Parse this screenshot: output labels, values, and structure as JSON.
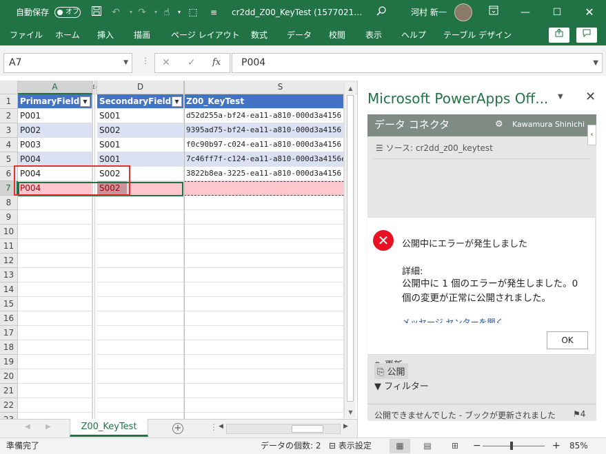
{
  "titlebar": {
    "autosave_label": "自動保存",
    "autosave_state": "オフ",
    "save_icon": "save-icon",
    "filename": "cr2dd_Z00_KeyTest (1577021…",
    "user_name": "河村 新一"
  },
  "ribbon": {
    "tabs": [
      "ファイル",
      "ホーム",
      "挿入",
      "描画",
      "ページ レイアウト",
      "数式",
      "データ",
      "校閲",
      "表示",
      "ヘルプ",
      "テーブル デザイン"
    ]
  },
  "formula_bar": {
    "name_box": "A7",
    "fx_label": "fx",
    "value": "P004"
  },
  "grid": {
    "columns": [
      "A",
      "D",
      "S"
    ],
    "hidden_col_marker": "E(",
    "row_numbers": [
      "1",
      "2",
      "3",
      "4",
      "5",
      "6",
      "7",
      "8",
      "9",
      "10",
      "11",
      "12",
      "13",
      "14",
      "15",
      "16",
      "17",
      "18",
      "19",
      "20",
      "21",
      "22",
      "23"
    ],
    "headers": [
      "PrimaryField",
      "SecondaryField",
      "Z00_KeyTest"
    ],
    "rows": [
      [
        "P001",
        "S001",
        "d52d255a-bf24-ea11-a810-000d3a4156"
      ],
      [
        "P002",
        "S002",
        "9395ad75-bf24-ea11-a810-000d3a4156"
      ],
      [
        "P003",
        "S001",
        "f0c90b97-c024-ea11-a810-000d3a4156"
      ],
      [
        "P004",
        "S001",
        "7c46ff7f-c124-ea11-a810-000d3a4156e"
      ],
      [
        "P004",
        "S002",
        "3822b8ea-3225-ea11-a810-000d3a4156"
      ],
      [
        "P004",
        "S002",
        ""
      ]
    ]
  },
  "sheet_tab": "Z00_KeyTest",
  "pane": {
    "title": "Microsoft PowerApps Off...",
    "connector_title": "データ コネクタ",
    "user": "Kawamura Shinichi",
    "source_label": "ソース: cr2dd_z00_keytest",
    "items": [
      "更新",
      "公開",
      "フィルター"
    ],
    "status": "公開できませんでした - ブックが更新されました",
    "flag_count": "4"
  },
  "dialog": {
    "title": "公開中にエラーが発生しました",
    "detail_heading": "詳細:",
    "detail": "公開中に 1 個のエラーが発生しました。0 個の変更が正常に公開されました。",
    "link": "メッセージ センターを開く",
    "ok": "OK"
  },
  "statusbar": {
    "ready": "準備完了",
    "count": "データの個数: 2",
    "display_settings": "表示設定",
    "zoom": "85%"
  },
  "colors": {
    "excel_green": "#217346",
    "table_header": "#4472c4",
    "table_band": "#d9e1f2",
    "error_fill": "#ffc7ce",
    "error_text": "#9c0006",
    "highlight_border": "#e03030"
  }
}
